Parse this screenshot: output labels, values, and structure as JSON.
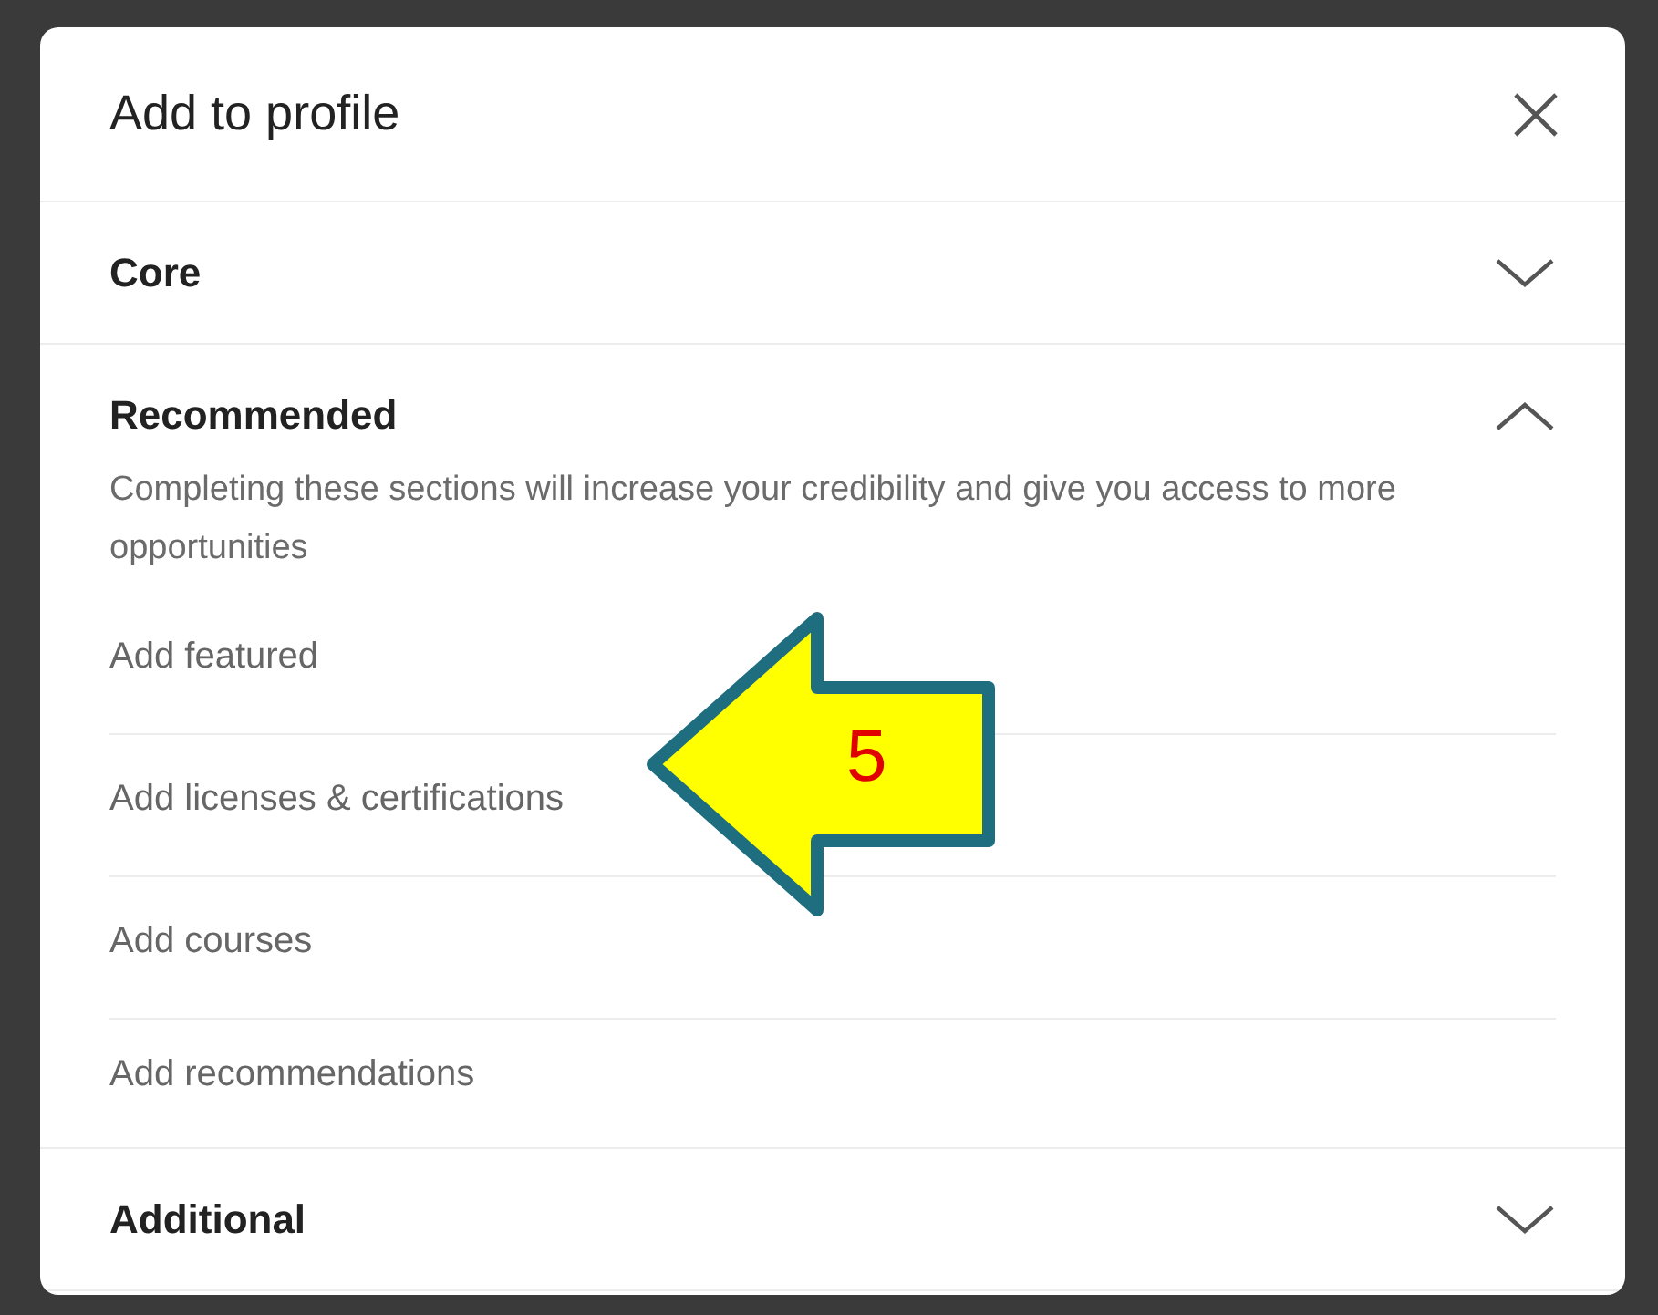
{
  "dialog": {
    "title": "Add to profile"
  },
  "sections": [
    {
      "title": "Core",
      "expanded": false
    },
    {
      "title": "Recommended",
      "expanded": true,
      "description": "Completing these sections will increase your credibility and give you access to more opportunities",
      "items": [
        "Add featured",
        "Add licenses & certifications",
        "Add courses",
        "Add recommendations"
      ]
    },
    {
      "title": "Additional",
      "expanded": false
    }
  ],
  "annotation": {
    "label": "5"
  }
}
